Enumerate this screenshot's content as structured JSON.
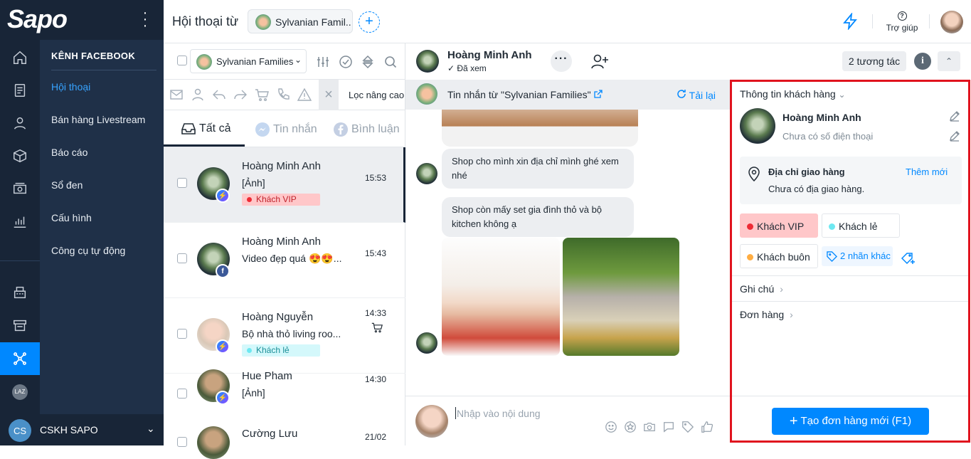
{
  "app": {
    "logo": "Sapo"
  },
  "topbar": {
    "title": "Hội thoại từ",
    "page_chip": "Sylvanian Famil..",
    "help_label": "Trợ giúp"
  },
  "menu": {
    "section": "KÊNH FACEBOOK",
    "items": [
      {
        "label": "Hội thoại",
        "active": true
      },
      {
        "label": "Bán hàng Livestream",
        "active": false
      },
      {
        "label": "Báo cáo",
        "active": false
      },
      {
        "label": "Sổ đen",
        "active": false
      },
      {
        "label": "Cấu hình",
        "active": false
      },
      {
        "label": "Công cụ tự động",
        "active": false
      }
    ],
    "account": {
      "initials": "CS",
      "name": "CSKH SAPO"
    },
    "laz": "LAZ"
  },
  "list": {
    "page_select": "Sylvanian Families",
    "advanced_filter": "Lọc nâng cao",
    "tabs": [
      {
        "label": "Tất cả",
        "active": true
      },
      {
        "label": "Tin nhắn",
        "active": false
      },
      {
        "label": "Bình luận",
        "active": false
      }
    ],
    "conversations": [
      {
        "name": "Hoàng Minh Anh",
        "preview": "[Ảnh]",
        "time": "15:53",
        "tag": "Khách VIP",
        "channel": "messenger",
        "selected": true
      },
      {
        "name": "Hoàng Minh Anh",
        "preview": "Video đẹp quá 😍😍...",
        "time": "15:43",
        "tag": "",
        "channel": "facebook",
        "selected": false
      },
      {
        "name": "Hoàng Nguyễn",
        "preview": "Bộ nhà thỏ living roo...",
        "time": "14:33",
        "tag": "Khách lẻ",
        "channel": "messenger",
        "selected": false
      },
      {
        "name": "Hue Pham",
        "preview": "[Ảnh]",
        "time": "14:30",
        "tag": "",
        "channel": "messenger",
        "selected": false
      },
      {
        "name": "Cường Lưu",
        "preview": "",
        "time": "21/02",
        "tag": "",
        "channel": "messenger",
        "selected": false
      }
    ]
  },
  "chat": {
    "name": "Hoàng Minh Anh",
    "status": "✓ Đã xem",
    "source": "Tin nhắn từ  \"Sylvanian Families\"",
    "reload": "Tải lại",
    "messages": [
      "Shop cho mình xin địa chỉ mình ghé xem nhé",
      "Shop còn mấy set gia đình thỏ và bộ kitchen không ạ"
    ],
    "compose_placeholder": "Nhập vào nội dung"
  },
  "customer": {
    "interactions": "2 tương tác",
    "info_title": "Thông tin khách hàng",
    "name": "Hoàng Minh Anh",
    "phone": "Chưa có số điện thoại",
    "address_title": "Địa chỉ giao hàng",
    "address_value": "Chưa có địa giao hàng.",
    "address_add": "Thêm mới",
    "tags": [
      "Khách VIP",
      "Khách lẻ",
      "Khách buôn"
    ],
    "more_tags": "2 nhãn khác",
    "notes": "Ghi chú",
    "orders": "Đơn hàng",
    "create_order": "Tạo đơn hàng mới (F1)"
  },
  "colors": {
    "accent": "#0088ff",
    "sidebar": "#182537",
    "vip": "#ee2b35",
    "highlight": "#e0131e"
  }
}
